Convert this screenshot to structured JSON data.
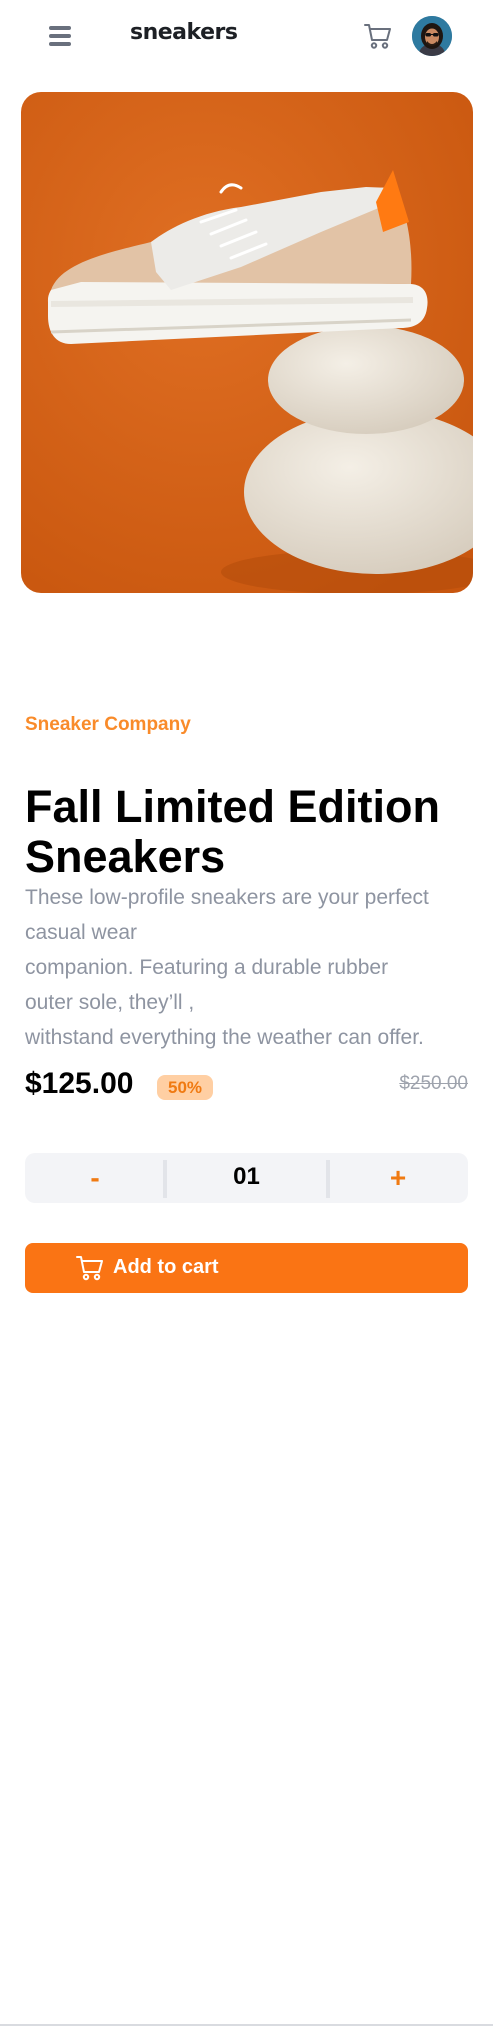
{
  "header": {
    "brand": "sneakers",
    "icons": [
      "menu-icon",
      "cart-icon",
      "avatar"
    ]
  },
  "product": {
    "company": "Sneaker Company",
    "title": "Fall Limited Edition Sneakers",
    "description_lines": [
      "These low-profile sneakers are your perfect",
      "casual wear",
      "companion. Featuring a durable rubber",
      "outer sole, they’ll ,",
      "withstand everything the weather can offer."
    ],
    "price": "$125.00",
    "discount": "50%",
    "original_price": "$250.00"
  },
  "quantity": {
    "minus_label": "-",
    "value": "01",
    "plus_label": "+"
  },
  "cart_button": {
    "label": "Add to cart"
  },
  "colors": {
    "accent": "#fa7414",
    "accent_pale": "#ffcfa3",
    "text_muted": "#8e94a1",
    "image_bg": "#d9641c"
  }
}
